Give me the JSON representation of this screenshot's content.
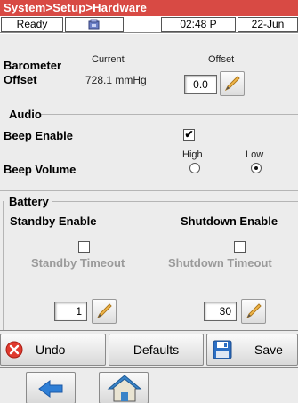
{
  "title": "System>Setup>Hardware",
  "status": {
    "state": "Ready",
    "icon": "device-icon",
    "time": "02:48 P",
    "date": "22-Jun"
  },
  "barometer": {
    "label_line1": "Barometer",
    "label_line2": "Offset",
    "current_header": "Current",
    "current_value": "728.1 mmHg",
    "offset_header": "Offset",
    "offset_value": "0.0"
  },
  "audio": {
    "group_label": "Audio",
    "beep_enable_label": "Beep Enable",
    "beep_enable_checked": true,
    "beep_volume_label": "Beep Volume",
    "high_label": "High",
    "low_label": "Low",
    "selected_volume": "Low"
  },
  "battery": {
    "group_label": "Battery",
    "standby_enable_label": "Standby Enable",
    "shutdown_enable_label": "Shutdown Enable",
    "standby_timeout_label": "Standby Timeout",
    "shutdown_timeout_label": "Shutdown Timeout",
    "standby_timeout_value": "1",
    "shutdown_timeout_value": "30"
  },
  "buttons": {
    "undo": "Undo",
    "defaults": "Defaults",
    "save": "Save"
  },
  "nav": {
    "back_icon": "back-arrow-icon",
    "home_icon": "home-icon"
  },
  "colors": {
    "title_bar": "#d84a44",
    "panel": "#ececec",
    "undo_icon": "#e03a2e",
    "save_icon": "#2c6fc4",
    "back_icon": "#2f7fd6"
  }
}
